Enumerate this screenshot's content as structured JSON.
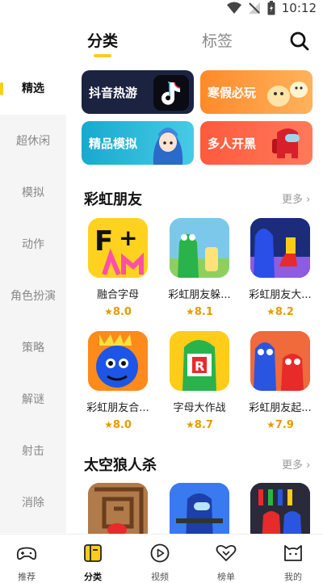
{
  "status_bar": {
    "time": "10:12"
  },
  "top_tabs": {
    "active": "分类",
    "inactive": "标签"
  },
  "sidebar": {
    "items": [
      {
        "label": "精选",
        "active": true
      },
      {
        "label": "超休闲"
      },
      {
        "label": "模拟"
      },
      {
        "label": "动作"
      },
      {
        "label": "角色扮演"
      },
      {
        "label": "策略"
      },
      {
        "label": "解谜"
      },
      {
        "label": "射击"
      },
      {
        "label": "消除"
      }
    ]
  },
  "banners": [
    {
      "label": "抖音热游",
      "color": "#1c2340"
    },
    {
      "label": "寒假必玩",
      "color": "#ff9a3c"
    },
    {
      "label": "精品模拟",
      "color": "#2ab8d6"
    },
    {
      "label": "多人开黑",
      "color": "#ff5a4a"
    }
  ],
  "sections": [
    {
      "title": "彩虹朋友",
      "more": "更多",
      "games": [
        {
          "name": "融合字母",
          "rating": "8.0"
        },
        {
          "name": "彩虹朋友躲...",
          "rating": "8.1"
        },
        {
          "name": "彩虹朋友大...",
          "rating": "8.2"
        },
        {
          "name": "彩虹朋友合...",
          "rating": "8.0"
        },
        {
          "name": "字母大作战",
          "rating": "8.7"
        },
        {
          "name": "彩虹朋友起...",
          "rating": "7.9"
        }
      ]
    },
    {
      "title": "太空狼人杀",
      "more": "更多",
      "games": []
    }
  ],
  "bottom_nav": [
    {
      "label": "推荐",
      "icon": "gamepad-icon"
    },
    {
      "label": "分类",
      "icon": "category-icon",
      "active": true
    },
    {
      "label": "视频",
      "icon": "play-icon"
    },
    {
      "label": "榜单",
      "icon": "rank-heart-icon"
    },
    {
      "label": "我的",
      "icon": "cat-face-icon"
    }
  ],
  "colors": {
    "accent": "#ffcc1a",
    "rating": "#e89a00"
  }
}
